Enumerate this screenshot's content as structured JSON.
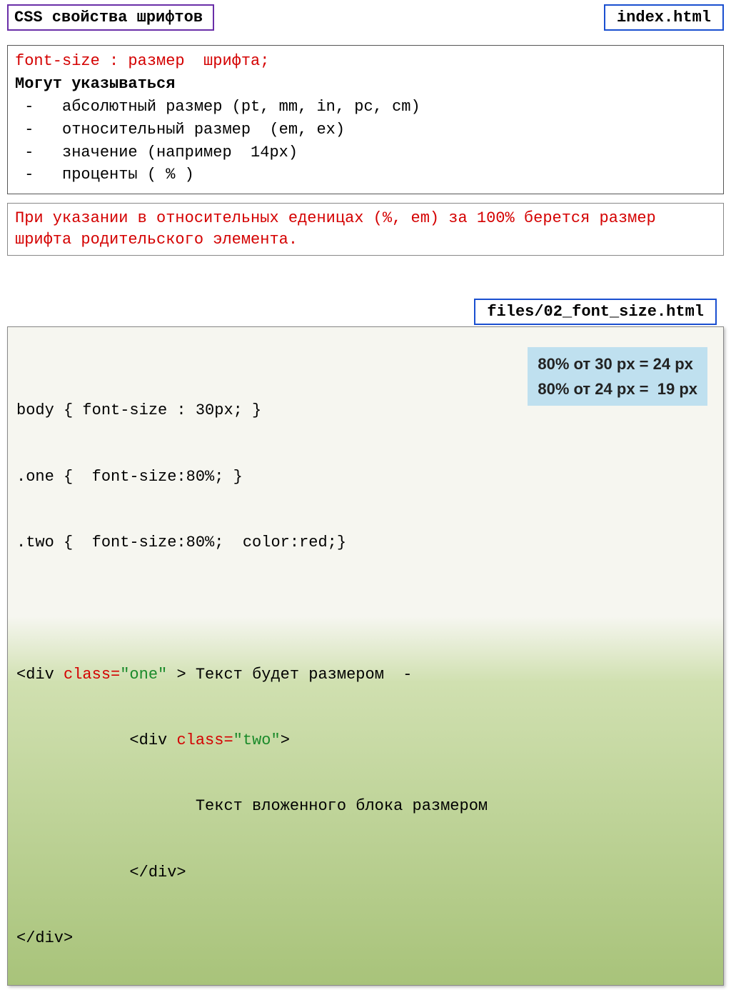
{
  "title": "CSS свойства шрифтов",
  "file1": "index.html",
  "desc": {
    "line1": "font-size : размер  шрифта;",
    "line2": " Могут указываться",
    "line3": " -   абсолютный размер (pt, mm, in, pc, cm)",
    "line4": " -   относительный размер  (em, ex)",
    "line5": " -   значение (например  14px)",
    "line6": " -   проценты ( % )"
  },
  "note": "При указании в относительных еденицах (%, em) за 100% берется размер шрифта родительского элемента.",
  "file2": "files/02_font_size.html",
  "code": {
    "l1": "body { font-size : 30px; }",
    "l2": ".one {  font-size:80%; }",
    "l3": ".two {  font-size:80%;  color:red;}",
    "l4a": "<div ",
    "l4b": "class=",
    "l4c": "\"one\"",
    "l4d": " > Текст будет размером  -",
    "l5a": "            <",
    "l5b": "div ",
    "l5c": "class=",
    "l5d": "\"two\"",
    "l5e": ">",
    "l6": "                   Текст вложенного блока размером",
    "l7": "            </div>",
    "l8": "</div>"
  },
  "calc": {
    "line1": "80% от 30 px = 24 px",
    "line2": "80% от 24 px =  19 px"
  }
}
